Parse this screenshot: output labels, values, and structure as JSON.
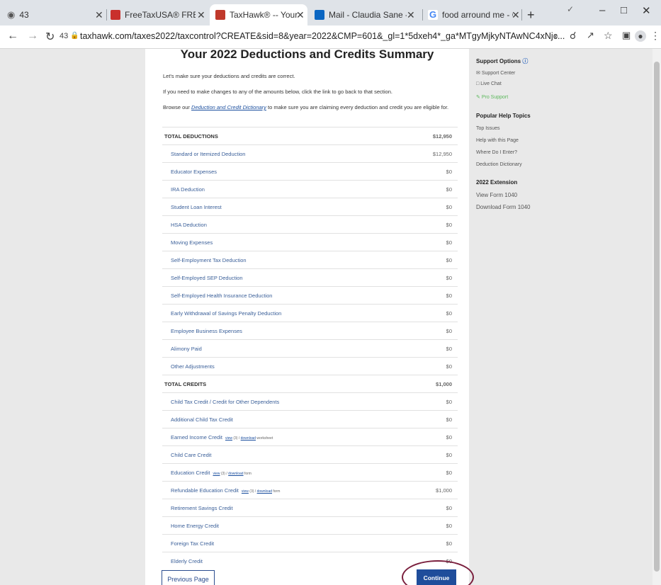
{
  "browser": {
    "tabs": [
      {
        "title": "43",
        "favicon_color": "#5f6368"
      },
      {
        "title": "FreeTaxUSA® FREE Ta",
        "favicon_color": "#c9302c"
      },
      {
        "title": "TaxHawk® -- Your 20",
        "favicon_color": "#c0392b"
      },
      {
        "title": "Mail - Claudia Sane -",
        "favicon_color": "#0a66c2"
      },
      {
        "title": "food arround me - G",
        "favicon_color": "#4285f4"
      }
    ],
    "new_tab": "+",
    "url": "taxhawk.com/taxes2022/taxcontrol?CREATE&sid=8&year=2022&CMP=601&_gl=1*5dxeh4*_ga*MTgyMjkyNTAwNC4xNjc...",
    "tab_count": "43"
  },
  "page": {
    "title": "Your 2022 Deductions and Credits Summary",
    "intro1": "Let's make sure your deductions and credits are correct.",
    "intro2": "If you need to make changes to any of the amounts below, click the link to go back to that section.",
    "intro3_pre": "Browse our ",
    "intro3_link": "Deduction and Credit Dictionary",
    "intro3_post": " to make sure you are claiming every deduction and credit you are eligible for.",
    "rows": [
      {
        "label": "TOTAL DEDUCTIONS",
        "value": "$12,950",
        "total": true
      },
      {
        "label": "Standard or Itemized Deduction",
        "value": "$12,950"
      },
      {
        "label": "Educator Expenses",
        "value": "$0"
      },
      {
        "label": "IRA Deduction",
        "value": "$0"
      },
      {
        "label": "Student Loan Interest",
        "value": "$0"
      },
      {
        "label": "HSA Deduction",
        "value": "$0"
      },
      {
        "label": "Moving Expenses",
        "value": "$0"
      },
      {
        "label": "Self-Employment Tax Deduction",
        "value": "$0"
      },
      {
        "label": "Self-Employed SEP Deduction",
        "value": "$0"
      },
      {
        "label": "Self-Employed Health Insurance Deduction",
        "value": "$0"
      },
      {
        "label": "Early Withdrawal of Savings Penalty Deduction",
        "value": "$0"
      },
      {
        "label": "Employee Business Expenses",
        "value": "$0"
      },
      {
        "label": "Alimony Paid",
        "value": "$0"
      },
      {
        "label": "Other Adjustments",
        "value": "$0"
      },
      {
        "label": "TOTAL CREDITS",
        "value": "$1,000",
        "total": true
      },
      {
        "label": "Child Tax Credit / Credit for Other Dependents",
        "value": "$0"
      },
      {
        "label": "Additional Child Tax Credit",
        "value": "$0"
      },
      {
        "label": "Earned Income Credit",
        "value": "$0",
        "links": {
          "view": "view",
          "sep": " (3) / ",
          "dl": "download",
          "tail": " worksheet"
        }
      },
      {
        "label": "Child Care Credit",
        "value": "$0"
      },
      {
        "label": "Education Credit",
        "value": "$0",
        "links": {
          "view": "view",
          "sep": " (3) / ",
          "dl": "download",
          "tail": " form"
        }
      },
      {
        "label": "Refundable Education Credit",
        "value": "$1,000",
        "links": {
          "view": "view",
          "sep": " (3) / ",
          "dl": "download",
          "tail": " form"
        }
      },
      {
        "label": "Retirement Savings Credit",
        "value": "$0"
      },
      {
        "label": "Home Energy Credit",
        "value": "$0"
      },
      {
        "label": "Foreign Tax Credit",
        "value": "$0"
      },
      {
        "label": "Elderly Credit",
        "value": "$0"
      }
    ],
    "prev_button": "Previous Page",
    "continue_button": "Continue"
  },
  "sidebar": {
    "support_title": "Support Options",
    "support_center": "Support Center",
    "live_chat": "Live Chat",
    "pro_support": "Pro Support",
    "help_title": "Popular Help Topics",
    "top_issues": "Top Issues",
    "help_page": "Help with this Page",
    "where_enter": "Where Do I Enter?",
    "dictionary": "Deduction Dictionary",
    "extension": "2022 Extension",
    "view_1040": "View Form 1040",
    "download_1040": "Download Form 1040"
  }
}
